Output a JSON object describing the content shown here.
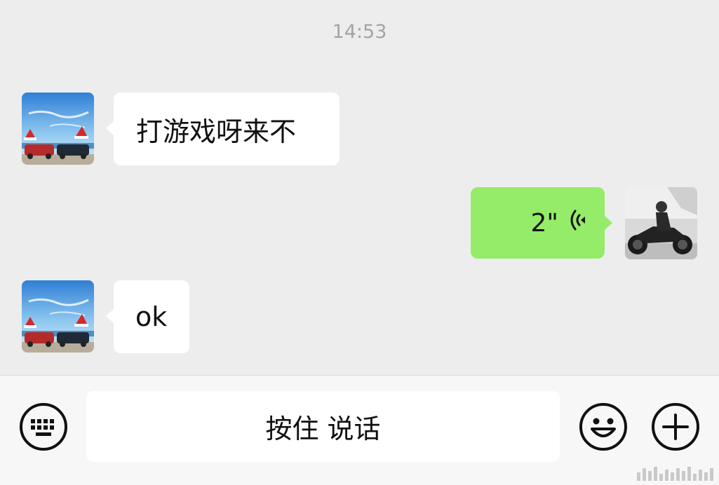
{
  "timestamp": "14:53",
  "messages": [
    {
      "side": "incoming",
      "type": "text",
      "text": "打游戏呀来不"
    },
    {
      "side": "outgoing",
      "type": "voice",
      "duration": "2\""
    },
    {
      "side": "incoming",
      "type": "text",
      "text": "ok"
    }
  ],
  "input_bar": {
    "hold_to_talk_label": "按住 说话"
  },
  "colors": {
    "background": "#ededed",
    "incoming_bubble": "#ffffff",
    "outgoing_bubble": "#95ec69",
    "timestamp_text": "#a3a3a3"
  },
  "icons": [
    "keyboard-icon",
    "voice-wave-icon",
    "emoji-icon",
    "plus-icon"
  ]
}
